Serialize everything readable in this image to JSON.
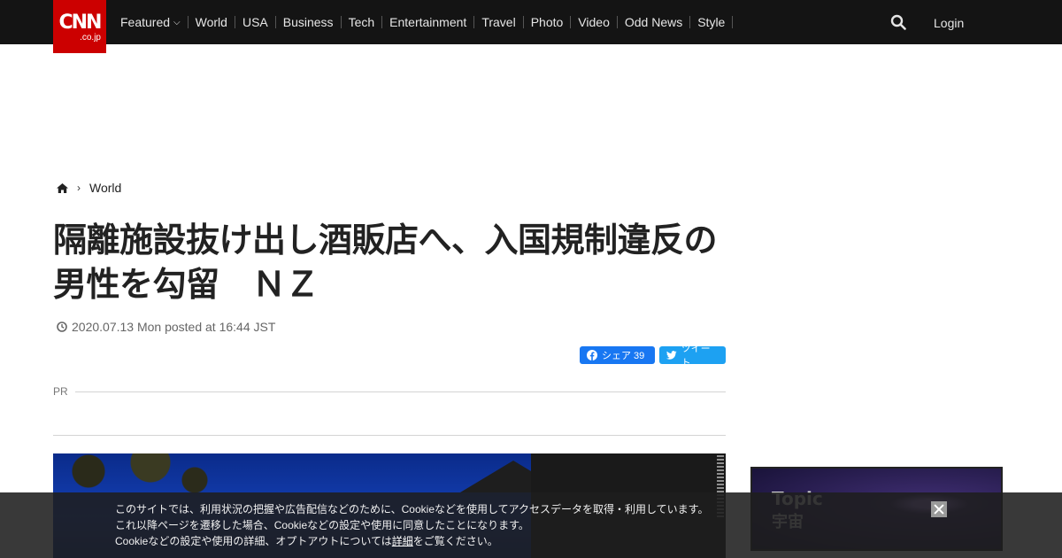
{
  "header": {
    "logo_main": "CNN",
    "logo_sub": ".co.jp",
    "nav": [
      "Featured",
      "World",
      "USA",
      "Business",
      "Tech",
      "Entertainment",
      "Travel",
      "Photo",
      "Video",
      "Odd News",
      "Style"
    ],
    "login": "Login"
  },
  "breadcrumb": {
    "section": "World"
  },
  "article": {
    "title": "隔離施設抜け出し酒販店へ、入国規制違反の男性を勾留　ＮＺ",
    "date": "2020.07.13 Mon posted at 16:44 JST",
    "share_fb": "シェア 39",
    "share_tw": "ツイート",
    "pr_label": "PR"
  },
  "side_ad": {
    "line1": "Topic",
    "line2": "宇宙"
  },
  "cookie": {
    "line1": "このサイトでは、利用状況の把握や広告配信などのために、Cookieなどを使用してアクセスデータを取得・利用しています。",
    "line2": "これ以降ページを遷移した場合、Cookieなどの設定や使用に同意したことになります。",
    "line3_pre": "Cookieなどの設定や使用の詳細、オプトアウトについては",
    "line3_link": "詳細",
    "line3_post": "をご覧ください。"
  },
  "colors": {
    "brand": "#cc0000",
    "topbar": "#141414",
    "facebook": "#1877f2",
    "twitter": "#1da1f2"
  }
}
